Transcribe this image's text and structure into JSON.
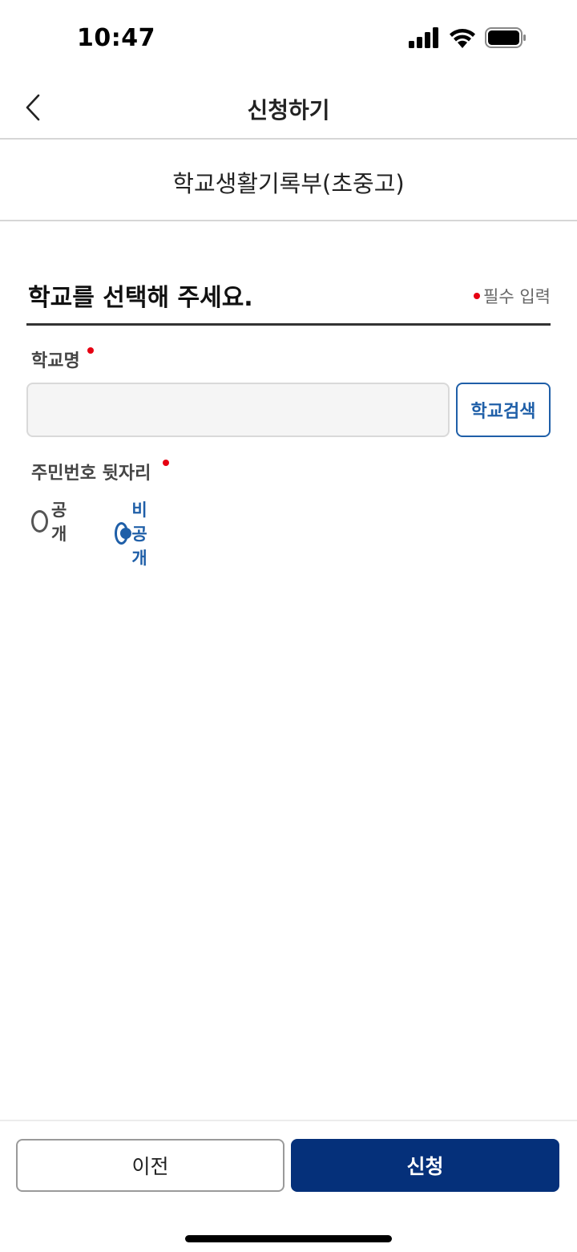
{
  "status_bar": {
    "time": "10:47",
    "icons": [
      "signal-icon",
      "wifi-icon",
      "battery-icon"
    ]
  },
  "nav": {
    "back_icon": "chevron-left-icon",
    "title": "신청하기"
  },
  "service": {
    "title": "학교생활기록부(초중고)"
  },
  "section": {
    "title": "학교를 선택해 주세요.",
    "required_note": "필수 입력"
  },
  "form": {
    "school_name": {
      "label": "학교명",
      "value": "",
      "search_button": "학교검색"
    },
    "resident_number": {
      "label": "주민번호 뒷자리",
      "options": [
        {
          "label": "공개",
          "selected": false
        },
        {
          "label": "비공개",
          "selected": true
        }
      ]
    }
  },
  "footer": {
    "prev_label": "이전",
    "submit_label": "신청"
  },
  "colors": {
    "primary": "#05307a",
    "accent_blue": "#1f5fa8",
    "required_red": "#e60012"
  }
}
